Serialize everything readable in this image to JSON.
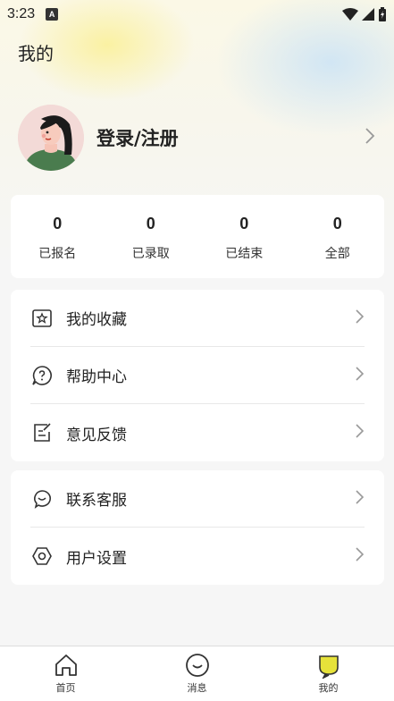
{
  "status_bar": {
    "time": "3:23",
    "notif_badge": "A"
  },
  "header": {
    "title": "我的"
  },
  "profile": {
    "login_label": "登录/注册"
  },
  "stats": [
    {
      "count": "0",
      "label": "已报名"
    },
    {
      "count": "0",
      "label": "已录取"
    },
    {
      "count": "0",
      "label": "已结束"
    },
    {
      "count": "0",
      "label": "全部"
    }
  ],
  "menu_group_1": [
    {
      "label": "我的收藏",
      "icon": "star-box-icon"
    },
    {
      "label": "帮助中心",
      "icon": "help-icon"
    },
    {
      "label": "意见反馈",
      "icon": "feedback-icon"
    }
  ],
  "menu_group_2": [
    {
      "label": "联系客服",
      "icon": "customer-service-icon"
    },
    {
      "label": "用户设置",
      "icon": "settings-icon"
    }
  ],
  "tabs": [
    {
      "label": "首页",
      "icon": "home-icon"
    },
    {
      "label": "消息",
      "icon": "message-icon"
    },
    {
      "label": "我的",
      "icon": "profile-icon"
    }
  ],
  "colors": {
    "accent": "#e6e23a",
    "text": "#222222",
    "icon": "#333333"
  }
}
